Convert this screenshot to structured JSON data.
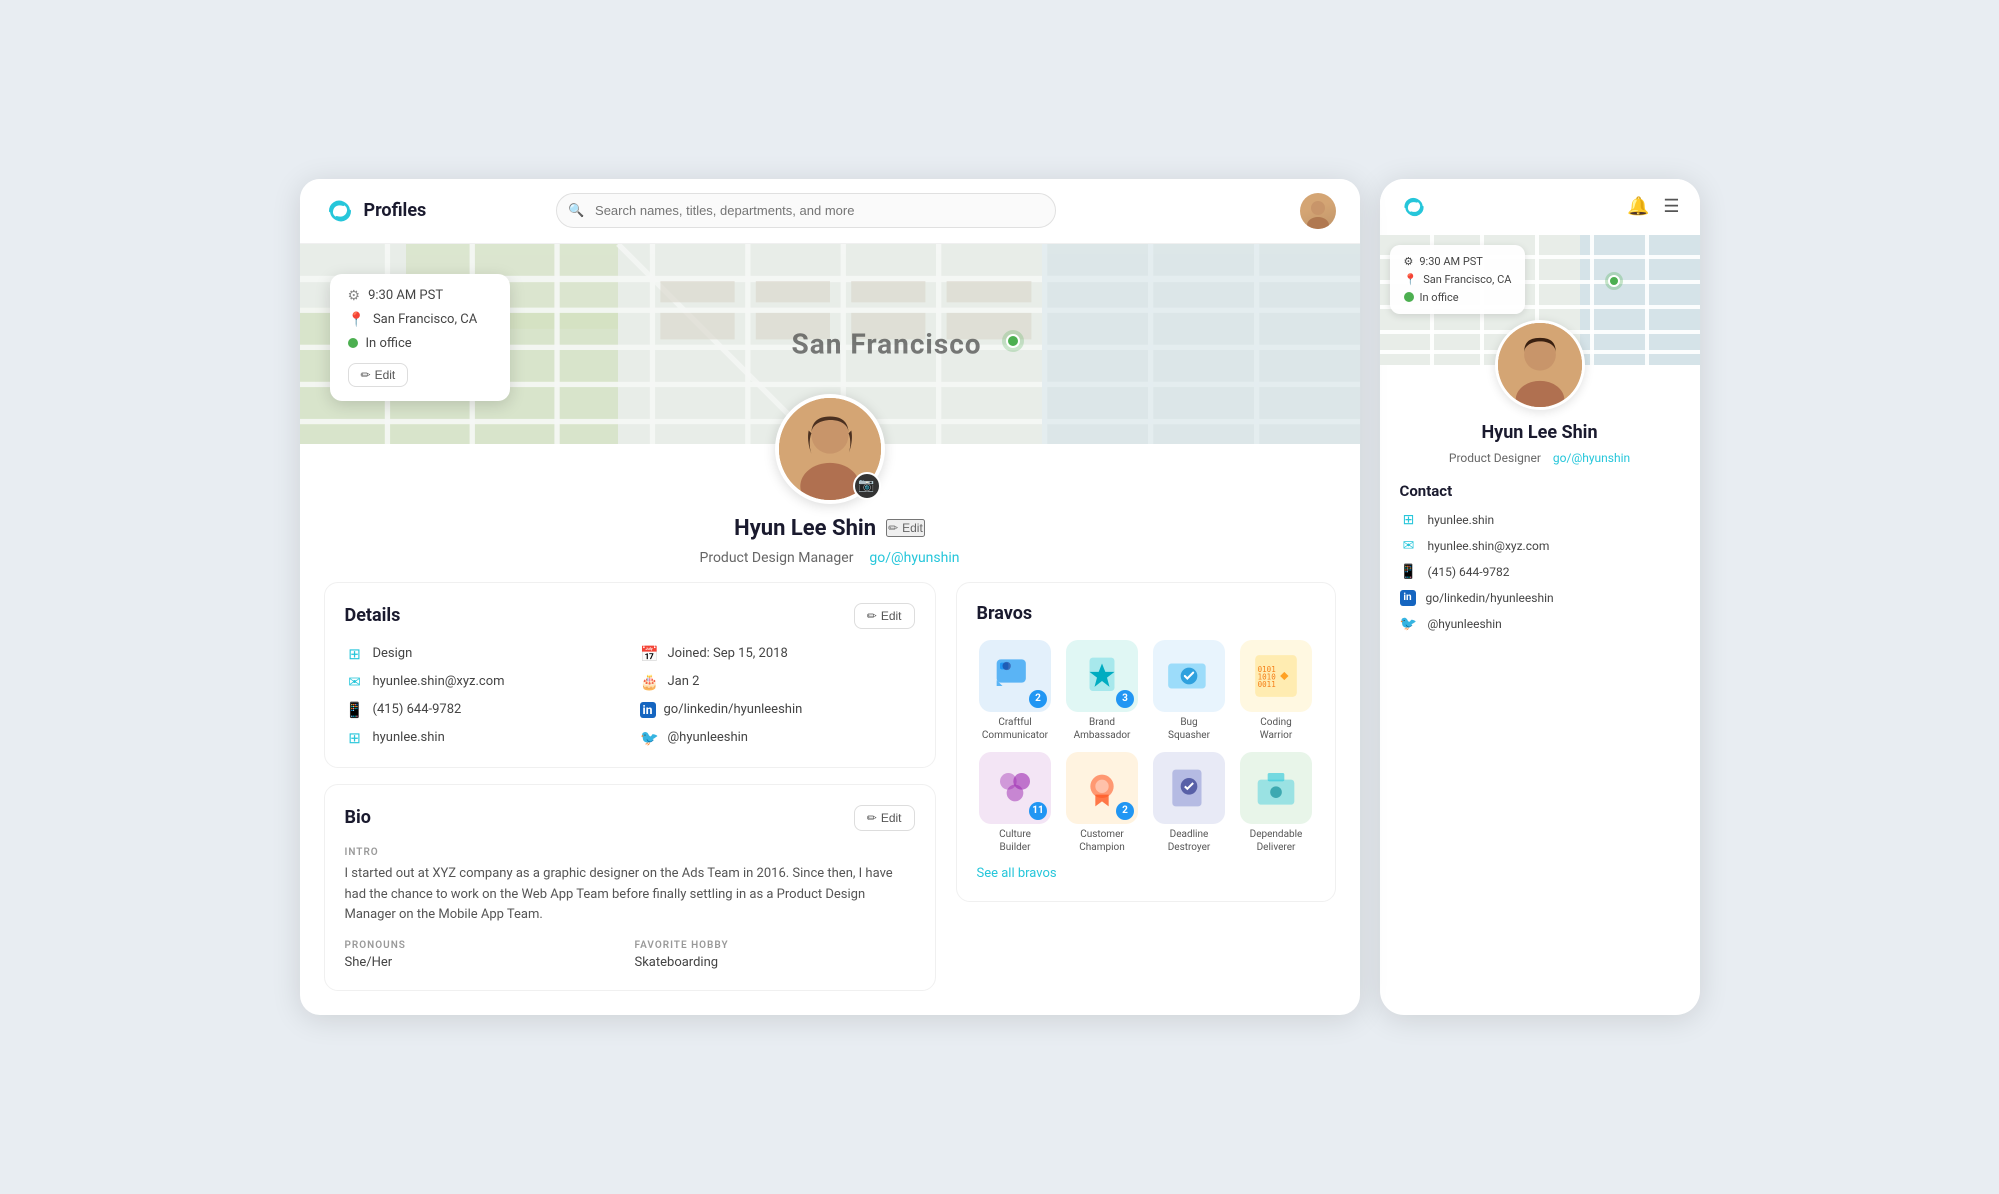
{
  "app": {
    "name": "Profiles",
    "search_placeholder": "Search names, titles, departments, and more"
  },
  "map": {
    "city": "San Francisco",
    "time": "9:30 AM PST",
    "location": "San Francisco, CA",
    "status": "In office",
    "mobile_time": "9:30 AM PST",
    "mobile_location": "San Francisco, CA",
    "mobile_status": "In office"
  },
  "profile": {
    "name": "Hyun Lee Shin",
    "title": "Product Design Manager",
    "link": "go/@hyunshin",
    "mobile_title": "Product Designer",
    "edit_label": "Edit"
  },
  "details": {
    "section_title": "Details",
    "edit_label": "Edit",
    "items_left": [
      {
        "icon": "🏢",
        "type": "teal",
        "value": "Design"
      },
      {
        "icon": "✉",
        "type": "teal",
        "value": "hyunlee.shin@xyz.com"
      },
      {
        "icon": "📱",
        "type": "green",
        "value": "(415) 644-9782"
      },
      {
        "icon": "🔷",
        "type": "teal",
        "value": "hyunlee.shin"
      }
    ],
    "items_right": [
      {
        "icon": "📅",
        "type": "teal",
        "value": "Joined: Sep 15, 2018"
      },
      {
        "icon": "🎂",
        "type": "teal",
        "value": "Jan 2"
      },
      {
        "icon": "in",
        "type": "blue",
        "value": "go/linkedin/hyunleeshin"
      },
      {
        "icon": "🐦",
        "type": "blue",
        "value": "@hyunleeshin"
      }
    ]
  },
  "bio": {
    "section_title": "Bio",
    "edit_label": "Edit",
    "intro_label": "INTRO",
    "intro_text": "I started out at XYZ company as a graphic designer on the Ads Team in 2016. Since then, I have had the chance to work on the Web App Team before finally settling in as a Product Design Manager on the Mobile App Team.",
    "pronouns_label": "PRONOUNS",
    "pronouns_value": "She/Her",
    "hobby_label": "FAVORITE HOBBY",
    "hobby_value": "Skateboarding"
  },
  "bravos": {
    "section_title": "Bravos",
    "see_all": "See all bravos",
    "items": [
      {
        "name": "Craftful Communicator",
        "count": 2,
        "emoji": "💬",
        "color": "bravo-blue"
      },
      {
        "name": "Brand Ambassador",
        "count": 3,
        "emoji": "⭐",
        "color": "bravo-teal"
      },
      {
        "name": "Bug Squasher",
        "count": null,
        "emoji": "🐛",
        "color": "bravo-light-blue"
      },
      {
        "name": "Coding Warrior",
        "count": null,
        "emoji": "⚔️",
        "color": "bravo-yellow"
      },
      {
        "name": "Culture Builder",
        "count": 11,
        "emoji": "🏗️",
        "color": "bravo-purple"
      },
      {
        "name": "Customer Champion",
        "count": 2,
        "emoji": "🏆",
        "color": "bravo-orange"
      },
      {
        "name": "Deadline Destroyer",
        "count": null,
        "emoji": "📋",
        "color": "bravo-dark"
      },
      {
        "name": "Dependable Deliverer",
        "count": null,
        "emoji": "📦",
        "color": "bravo-green"
      }
    ]
  },
  "mobile_contact": {
    "title": "Contact",
    "items": [
      {
        "icon": "🔷",
        "type": "teal",
        "value": "hyunlee.shin"
      },
      {
        "icon": "✉",
        "type": "teal",
        "value": "hyunlee.shin@xyz.com"
      },
      {
        "icon": "📱",
        "type": "green",
        "value": "(415) 644-9782"
      },
      {
        "icon": "in",
        "type": "blue",
        "value": "go/linkedin/hyunleeshin"
      },
      {
        "icon": "🐦",
        "type": "blue",
        "value": "@hyunleeshin"
      }
    ]
  }
}
